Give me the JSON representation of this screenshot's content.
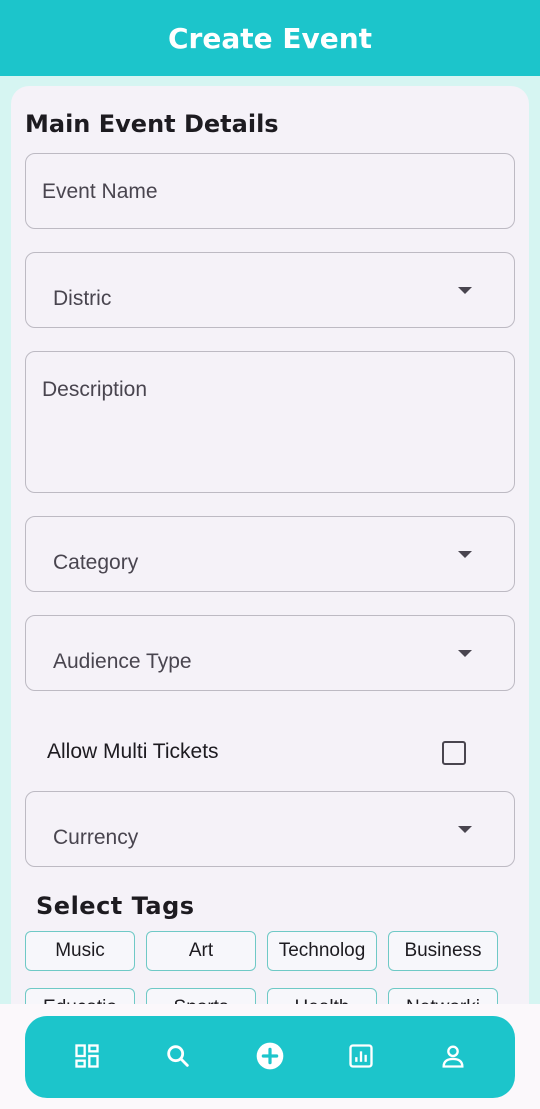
{
  "header": {
    "title": "Create Event"
  },
  "form": {
    "section_title": "Main Event Details",
    "event_name_placeholder": "Event Name",
    "district_placeholder": "Distric",
    "description_placeholder": "Description",
    "category_placeholder": "Category",
    "audience_type_placeholder": "Audience Type",
    "allow_multi_tickets_label": "Allow Multi Tickets",
    "allow_multi_tickets_checked": false,
    "currency_placeholder": "Currency"
  },
  "tags": {
    "title": "Select Tags",
    "items": [
      "Music",
      "Art",
      "Technolog",
      "Business",
      "Educatio",
      "Sports",
      "Health",
      "Networki"
    ]
  },
  "bottom_nav": {
    "items": [
      {
        "icon": "dashboard-icon"
      },
      {
        "icon": "search-icon"
      },
      {
        "icon": "add-circle-icon"
      },
      {
        "icon": "analytics-icon"
      },
      {
        "icon": "profile-icon"
      }
    ]
  },
  "colors": {
    "primary": "#1cc5cb",
    "background": "#d6f5f2",
    "card": "#f5f2f8",
    "tag_border": "#6fc9c6"
  }
}
